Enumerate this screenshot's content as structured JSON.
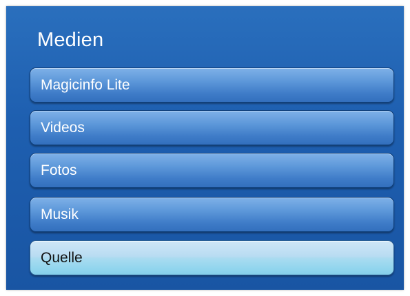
{
  "menu": {
    "title": "Medien",
    "items": [
      {
        "label": "Magicinfo Lite",
        "selected": false
      },
      {
        "label": "Videos",
        "selected": false
      },
      {
        "label": "Fotos",
        "selected": false
      },
      {
        "label": "Musik",
        "selected": false
      },
      {
        "label": "Quelle",
        "selected": true
      }
    ]
  },
  "colors": {
    "panel": "#1e5fb0",
    "item": "#4a88d0",
    "selected_item": "#a9dbf0",
    "text": "#ffffff",
    "selected_text": "#111111"
  }
}
